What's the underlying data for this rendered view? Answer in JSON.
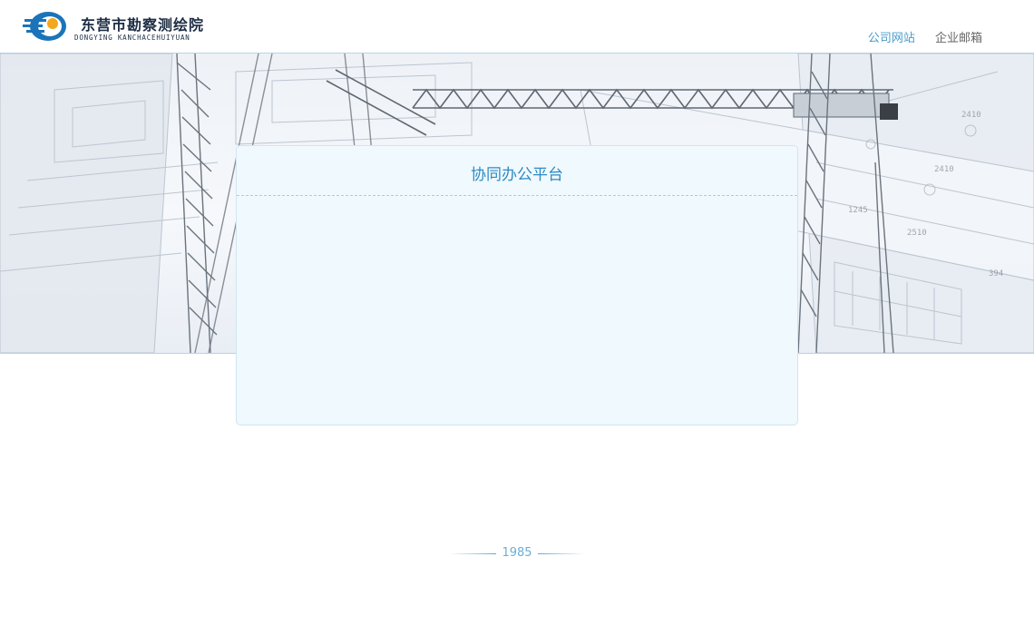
{
  "header": {
    "logo_cn": "东营市勘察测绘院",
    "logo_en": "DONGYING KANCHACEHUIYUAN",
    "logo_icon": "dongying-survey-logo",
    "nav": [
      {
        "label": "公司网站",
        "active": true
      },
      {
        "label": "企业邮箱",
        "active": false
      }
    ]
  },
  "banner": {
    "image": "tower-crane-over-blueprints"
  },
  "panel": {
    "title": "协同办公平台"
  },
  "footer": {
    "year": "1985"
  },
  "colors": {
    "accent": "#4a9cc9",
    "title": "#2f8ac2",
    "panel_bg": "#f0f9fd",
    "logo_text": "#1d2d44"
  }
}
